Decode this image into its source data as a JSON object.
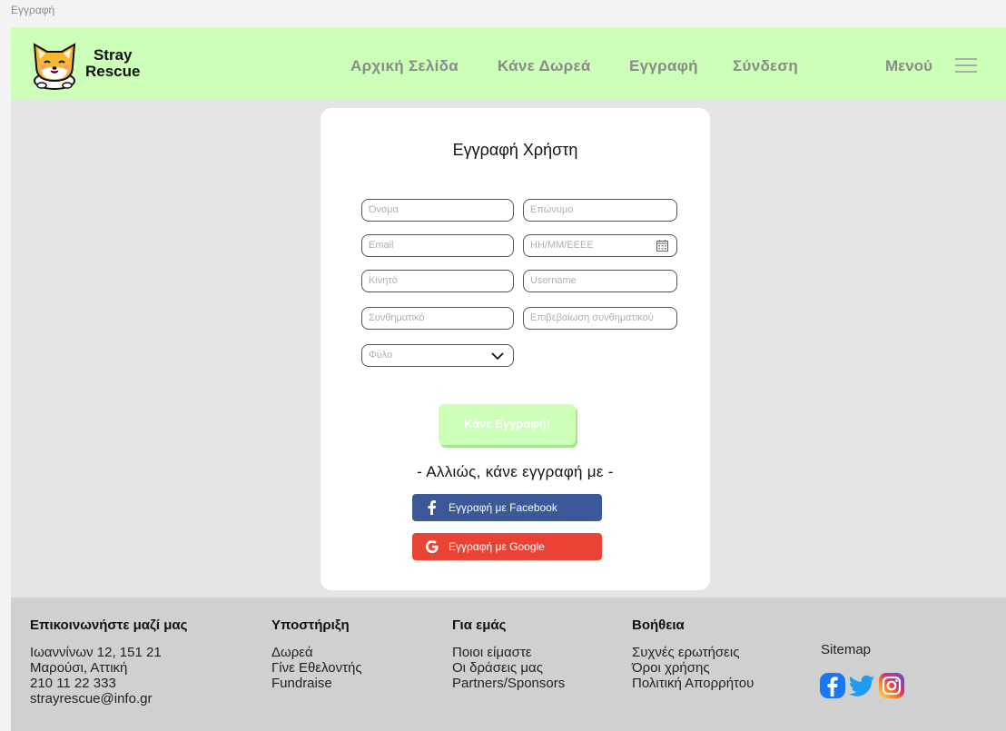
{
  "frame_label": "Εγγραφή",
  "header": {
    "brand_line1": "Stray",
    "brand_line2": "Rescue",
    "nav": [
      "Αρχική Σελίδα",
      "Κάνε Δωρεά",
      "Εγγραφή",
      "Σύνδεση"
    ],
    "menu_label": "Μενού"
  },
  "form": {
    "title": "Εγγραφή Χρήστη",
    "fields": {
      "first_name": "Όνομα",
      "last_name": "Επώνυμο",
      "email": "Email",
      "birthdate": "ΗΗ/ΜΜ/ΕΕΕΕ",
      "mobile": "Κινητό",
      "username": "Username",
      "password": "Συνθηματικό",
      "confirm_password": "Επιβεβαίωση συνθηματικού",
      "gender": "Φύλο"
    },
    "submit_label": "Κάνε Εγγραφή!",
    "or_text": "- Αλλιώς, κάνε εγγραφή με -",
    "facebook_label": "Εγγραφή με Facebook",
    "google_label": "Εγγραφή με Google"
  },
  "footer": {
    "contact": {
      "title": "Επικοινωνήστε μαζί μας",
      "lines": [
        "Ιωαννίνων 12, 151 21",
        "Μαρούσι, Αττική",
        "210 11 22 333",
        "strayrescue@info.gr"
      ]
    },
    "support": {
      "title": "Υποστήριξη",
      "links": [
        "Δωρεά",
        "Γίνε Εθελοντής",
        "Fundraise"
      ]
    },
    "about": {
      "title": "Για εμάς",
      "links": [
        "Ποιοι είμαστε",
        "Οι δράσεις μας",
        "Partners/Sponsors"
      ]
    },
    "help": {
      "title": "Βοήθεια",
      "links": [
        "Συχνές ερωτήσεις",
        "Όροι χρήσης",
        "Πολιτική Απορρήτου"
      ]
    },
    "sitemap": "Sitemap"
  },
  "colors": {
    "header_bg": "#ccffb8",
    "facebook": "#3b5998",
    "google": "#ea4335",
    "footer_bg": "#d0d0d0"
  }
}
